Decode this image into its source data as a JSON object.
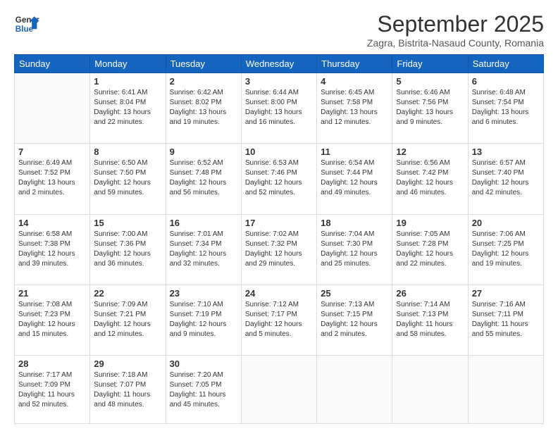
{
  "logo": {
    "line1": "General",
    "line2": "Blue"
  },
  "title": "September 2025",
  "subtitle": "Zagra, Bistrita-Nasaud County, Romania",
  "headers": [
    "Sunday",
    "Monday",
    "Tuesday",
    "Wednesday",
    "Thursday",
    "Friday",
    "Saturday"
  ],
  "weeks": [
    [
      {
        "day": "",
        "info": ""
      },
      {
        "day": "1",
        "info": "Sunrise: 6:41 AM\nSunset: 8:04 PM\nDaylight: 13 hours\nand 22 minutes."
      },
      {
        "day": "2",
        "info": "Sunrise: 6:42 AM\nSunset: 8:02 PM\nDaylight: 13 hours\nand 19 minutes."
      },
      {
        "day": "3",
        "info": "Sunrise: 6:44 AM\nSunset: 8:00 PM\nDaylight: 13 hours\nand 16 minutes."
      },
      {
        "day": "4",
        "info": "Sunrise: 6:45 AM\nSunset: 7:58 PM\nDaylight: 13 hours\nand 12 minutes."
      },
      {
        "day": "5",
        "info": "Sunrise: 6:46 AM\nSunset: 7:56 PM\nDaylight: 13 hours\nand 9 minutes."
      },
      {
        "day": "6",
        "info": "Sunrise: 6:48 AM\nSunset: 7:54 PM\nDaylight: 13 hours\nand 6 minutes."
      }
    ],
    [
      {
        "day": "7",
        "info": "Sunrise: 6:49 AM\nSunset: 7:52 PM\nDaylight: 13 hours\nand 2 minutes."
      },
      {
        "day": "8",
        "info": "Sunrise: 6:50 AM\nSunset: 7:50 PM\nDaylight: 12 hours\nand 59 minutes."
      },
      {
        "day": "9",
        "info": "Sunrise: 6:52 AM\nSunset: 7:48 PM\nDaylight: 12 hours\nand 56 minutes."
      },
      {
        "day": "10",
        "info": "Sunrise: 6:53 AM\nSunset: 7:46 PM\nDaylight: 12 hours\nand 52 minutes."
      },
      {
        "day": "11",
        "info": "Sunrise: 6:54 AM\nSunset: 7:44 PM\nDaylight: 12 hours\nand 49 minutes."
      },
      {
        "day": "12",
        "info": "Sunrise: 6:56 AM\nSunset: 7:42 PM\nDaylight: 12 hours\nand 46 minutes."
      },
      {
        "day": "13",
        "info": "Sunrise: 6:57 AM\nSunset: 7:40 PM\nDaylight: 12 hours\nand 42 minutes."
      }
    ],
    [
      {
        "day": "14",
        "info": "Sunrise: 6:58 AM\nSunset: 7:38 PM\nDaylight: 12 hours\nand 39 minutes."
      },
      {
        "day": "15",
        "info": "Sunrise: 7:00 AM\nSunset: 7:36 PM\nDaylight: 12 hours\nand 36 minutes."
      },
      {
        "day": "16",
        "info": "Sunrise: 7:01 AM\nSunset: 7:34 PM\nDaylight: 12 hours\nand 32 minutes."
      },
      {
        "day": "17",
        "info": "Sunrise: 7:02 AM\nSunset: 7:32 PM\nDaylight: 12 hours\nand 29 minutes."
      },
      {
        "day": "18",
        "info": "Sunrise: 7:04 AM\nSunset: 7:30 PM\nDaylight: 12 hours\nand 25 minutes."
      },
      {
        "day": "19",
        "info": "Sunrise: 7:05 AM\nSunset: 7:28 PM\nDaylight: 12 hours\nand 22 minutes."
      },
      {
        "day": "20",
        "info": "Sunrise: 7:06 AM\nSunset: 7:25 PM\nDaylight: 12 hours\nand 19 minutes."
      }
    ],
    [
      {
        "day": "21",
        "info": "Sunrise: 7:08 AM\nSunset: 7:23 PM\nDaylight: 12 hours\nand 15 minutes."
      },
      {
        "day": "22",
        "info": "Sunrise: 7:09 AM\nSunset: 7:21 PM\nDaylight: 12 hours\nand 12 minutes."
      },
      {
        "day": "23",
        "info": "Sunrise: 7:10 AM\nSunset: 7:19 PM\nDaylight: 12 hours\nand 9 minutes."
      },
      {
        "day": "24",
        "info": "Sunrise: 7:12 AM\nSunset: 7:17 PM\nDaylight: 12 hours\nand 5 minutes."
      },
      {
        "day": "25",
        "info": "Sunrise: 7:13 AM\nSunset: 7:15 PM\nDaylight: 12 hours\nand 2 minutes."
      },
      {
        "day": "26",
        "info": "Sunrise: 7:14 AM\nSunset: 7:13 PM\nDaylight: 11 hours\nand 58 minutes."
      },
      {
        "day": "27",
        "info": "Sunrise: 7:16 AM\nSunset: 7:11 PM\nDaylight: 11 hours\nand 55 minutes."
      }
    ],
    [
      {
        "day": "28",
        "info": "Sunrise: 7:17 AM\nSunset: 7:09 PM\nDaylight: 11 hours\nand 52 minutes."
      },
      {
        "day": "29",
        "info": "Sunrise: 7:18 AM\nSunset: 7:07 PM\nDaylight: 11 hours\nand 48 minutes."
      },
      {
        "day": "30",
        "info": "Sunrise: 7:20 AM\nSunset: 7:05 PM\nDaylight: 11 hours\nand 45 minutes."
      },
      {
        "day": "",
        "info": ""
      },
      {
        "day": "",
        "info": ""
      },
      {
        "day": "",
        "info": ""
      },
      {
        "day": "",
        "info": ""
      }
    ]
  ]
}
